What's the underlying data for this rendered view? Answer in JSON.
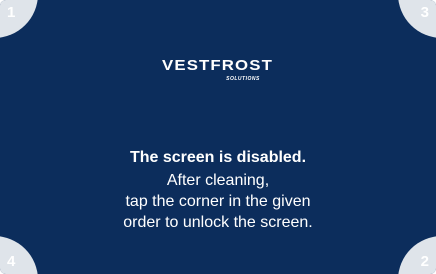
{
  "corners": {
    "top_left": "1",
    "top_right": "3",
    "bottom_right": "2",
    "bottom_left": "4"
  },
  "logo": {
    "brand": "VESTFROST",
    "tagline": "SOLUTIONS"
  },
  "message": {
    "title": "The screen is disabled.",
    "lines": [
      "After cleaning,",
      "tap the corner in the given",
      "order to unlock the screen."
    ]
  },
  "colors": {
    "background": "#0c2d5c",
    "corner": "#dfe4ea",
    "text": "#ffffff"
  }
}
